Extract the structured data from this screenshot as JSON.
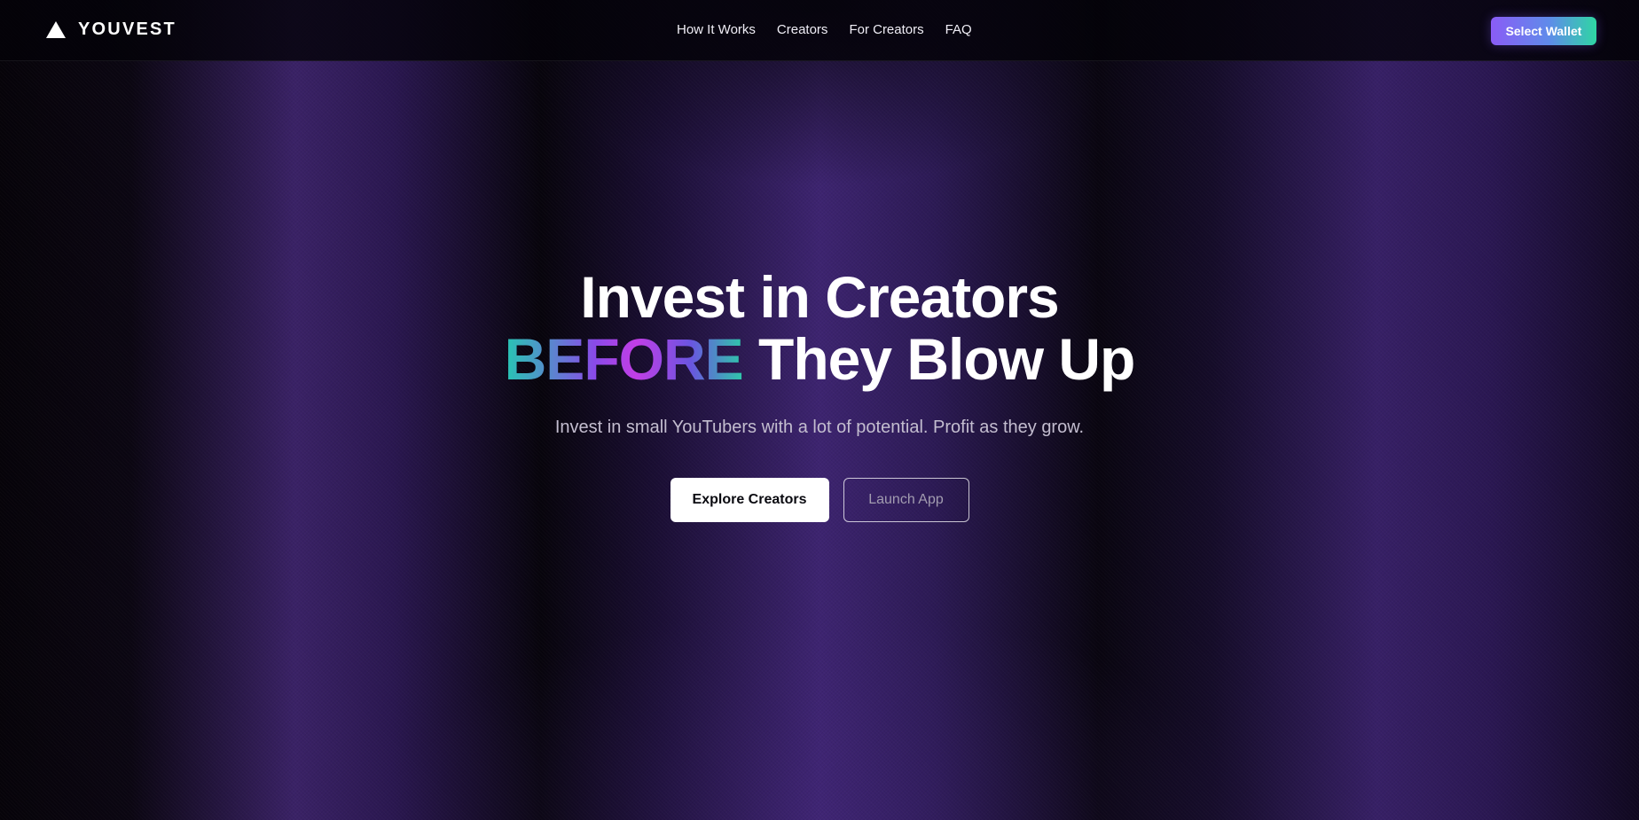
{
  "brand": {
    "name": "YOUVEST",
    "icon": "triangle-logo-icon"
  },
  "nav": {
    "links": [
      {
        "label": "How It Works"
      },
      {
        "label": "Creators"
      },
      {
        "label": "For Creators"
      },
      {
        "label": "FAQ"
      }
    ],
    "wallet_button": "Select Wallet"
  },
  "hero": {
    "title_line1": "Invest in Creators",
    "title_highlight": "BEFORE",
    "title_line2_rest": " They Blow Up",
    "subtitle": "Invest in small YouTubers with a lot of potential. Profit as they grow.",
    "primary_cta": "Explore Creators",
    "secondary_cta": "Launch App"
  },
  "colors": {
    "background": "#050308",
    "accent_purple": "#8a5cf6",
    "accent_teal": "#2fd6a4",
    "text_primary": "#ffffff",
    "text_muted": "#c3bdcf"
  }
}
